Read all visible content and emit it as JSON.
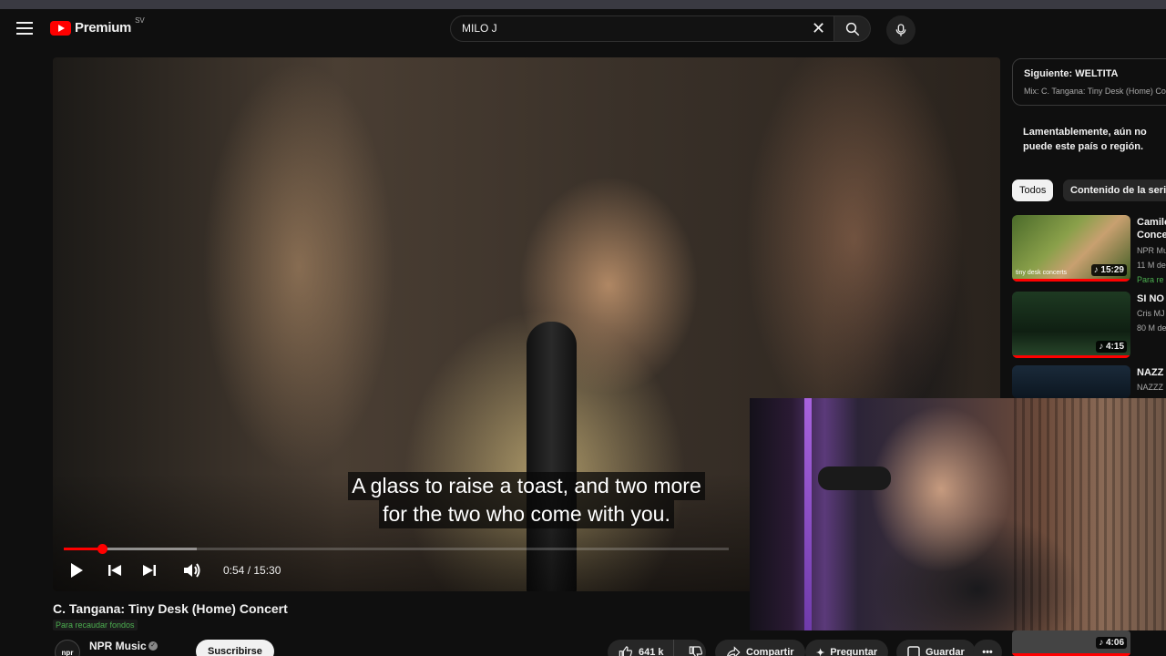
{
  "header": {
    "logo_text": "Premium",
    "region": "SV",
    "search_value": "MILO J"
  },
  "player": {
    "caption_line1": "A glass to raise a toast, and two more",
    "caption_line2": "for the two who come with you.",
    "time_display": "0:54 / 15:30",
    "progress_played_fraction": 0.058,
    "progress_buffered_fraction": 0.2
  },
  "video": {
    "title": "C. Tangana: Tiny Desk (Home) Concert",
    "fundraising_tag": "Para recaudar fondos",
    "channel_name": "NPR Music",
    "channel_avatar_text": "npr",
    "subscribe_label": "Suscribirse",
    "like_count": "641 k",
    "share_label": "Compartir",
    "ask_label": "Preguntar",
    "save_label": "Guardar"
  },
  "sidebar": {
    "next_title": "Siguiente: WELTITA",
    "next_sub": "Mix: C. Tangana: Tiny Desk (Home) Co",
    "region_message": "Lamentablemente, aún no puede este país o región.",
    "chips": [
      "Todos",
      "Contenido de la serie"
    ],
    "recommendations": [
      {
        "title": "Camilo",
        "title2": "Conce",
        "meta1": "NPR Mu",
        "meta2": "11 M de",
        "extra": "Para re",
        "duration": "15:29",
        "thumb_caption": "tiny desk concerts"
      },
      {
        "title": "SI NO",
        "meta1": "Cris MJ",
        "meta2": "80 M de",
        "duration": "4:15"
      },
      {
        "title": "NAZZ",
        "meta1": "NAZZZ",
        "duration": ""
      },
      {
        "duration": "4:06"
      }
    ]
  },
  "colors": {
    "accent": "#ff0000",
    "background": "#0f0f0f",
    "fund_green": "#4caf50"
  }
}
